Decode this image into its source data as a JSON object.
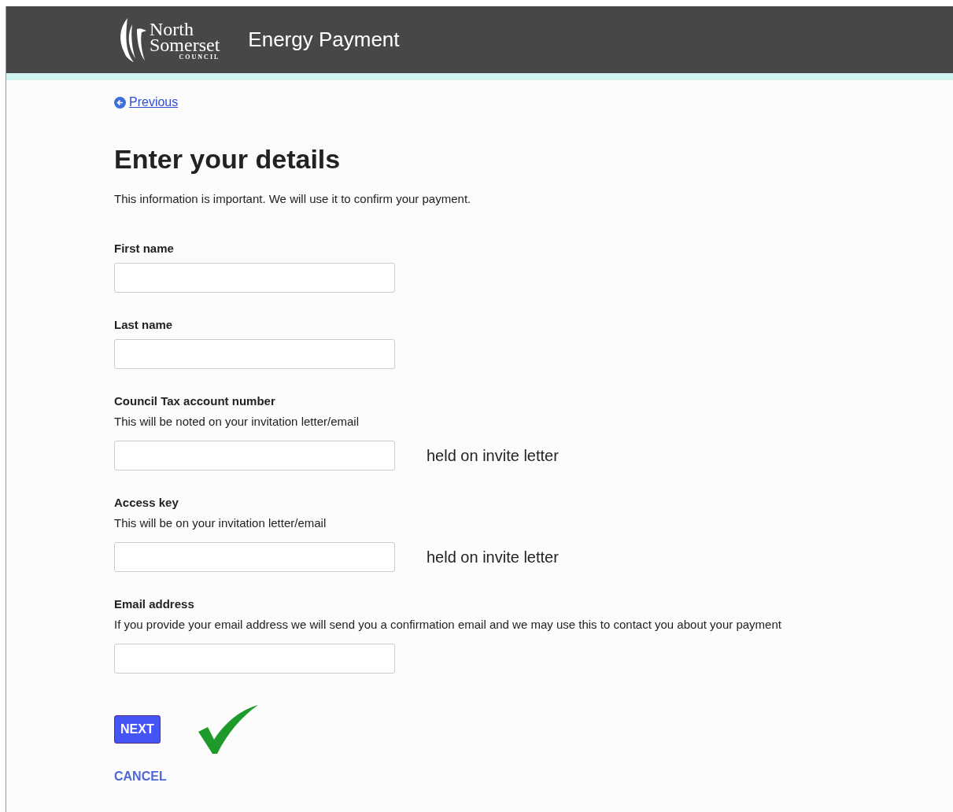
{
  "header": {
    "logo": {
      "line1": "North",
      "line2": "Somerset",
      "line3": "COUNCIL"
    },
    "title": "Energy Payment"
  },
  "back_link": "Previous",
  "heading": "Enter your details",
  "intro": "This information is important. We will use it to confirm your payment.",
  "fields": [
    {
      "label": "First name"
    },
    {
      "label": "Last name"
    },
    {
      "label": "Council Tax account number",
      "hint": "This will be noted on your invitation letter/email",
      "note": "held on invite letter"
    },
    {
      "label": "Access key",
      "hint": "This will be on your invitation letter/email",
      "note": "held on invite letter"
    },
    {
      "label": "Email address",
      "hint": "If you provide your email address we will send you a confirmation email and we may use this to contact you about your payment"
    }
  ],
  "next_button": "NEXT",
  "cancel_link": "CANCEL"
}
